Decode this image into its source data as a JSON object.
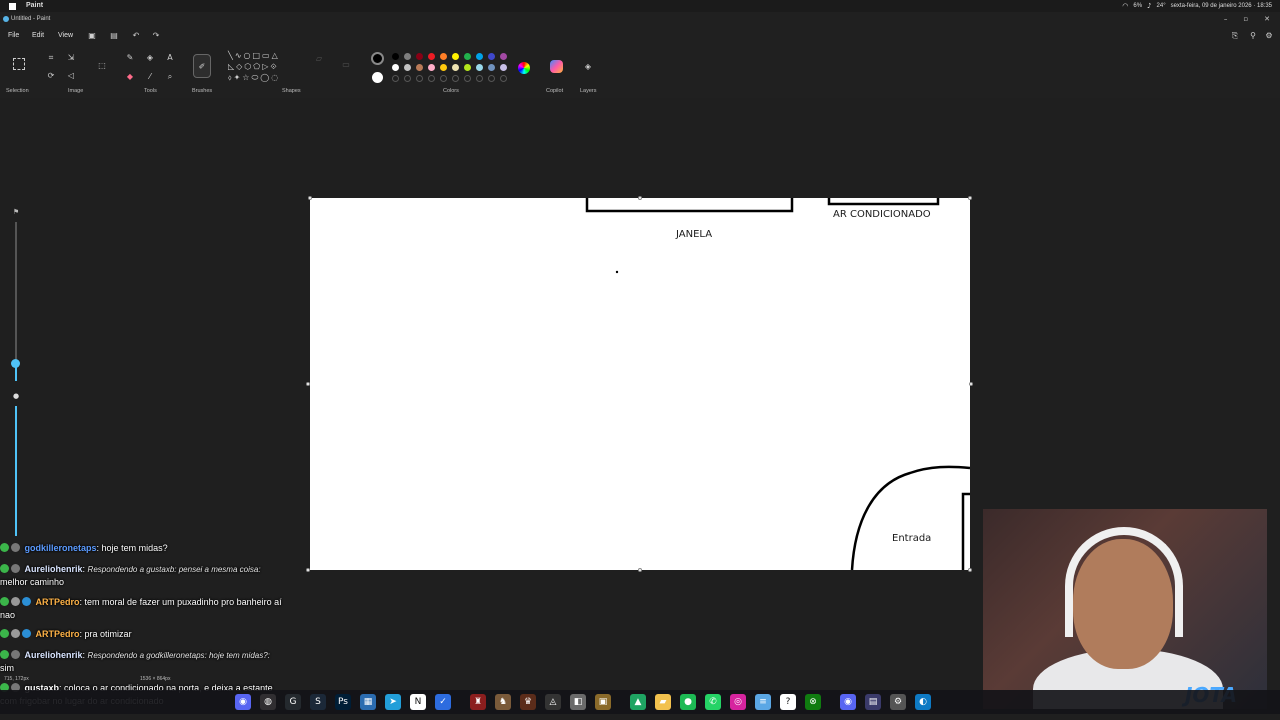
{
  "system_bar": {
    "app_name": "Paint",
    "temperature": "24°",
    "battery": "6%",
    "datetime": "sexta-feira, 09 de janeiro 2026 · 18:35"
  },
  "title_bar": {
    "document": "Untitled - Paint"
  },
  "menu": {
    "file": "File",
    "edit": "Edit",
    "view": "View"
  },
  "ribbon": {
    "groups": {
      "selection": "Selection",
      "image": "Image",
      "tools": "Tools",
      "brushes": "Brushes",
      "shapes": "Shapes",
      "colors": "Colors",
      "copilot": "Copilot",
      "layers": "Layers"
    },
    "palette_row1": [
      "#000000",
      "#7f7f7f",
      "#880015",
      "#ed1c24",
      "#ff7f27",
      "#fff200",
      "#22b14c",
      "#00a2e8",
      "#3f48cc",
      "#a349a4"
    ],
    "palette_row2": [
      "#ffffff",
      "#c3c3c3",
      "#b97a57",
      "#ffaec9",
      "#ffc90e",
      "#efe4b0",
      "#b5e61d",
      "#99d9ea",
      "#7092be",
      "#c8bfe7"
    ],
    "primary_color": "#000000",
    "secondary_color": "#ffffff"
  },
  "canvas": {
    "labels": {
      "window": "JANELA",
      "ac": "AR CONDICIONADO",
      "entrance": "Entrada"
    },
    "cursor_pos": "715, 172px",
    "canvas_size": "1536 × 864px"
  },
  "chat": [
    {
      "user": "godkilleronetaps",
      "user_color": "#5b9bff",
      "text": "hoje tem midas?",
      "reply": ""
    },
    {
      "user": "Aureliohenrik",
      "user_color": "#d8e4ff",
      "text": "melhor caminho",
      "reply": "Respondendo a gustaxb: pensei a mesma coisa:"
    },
    {
      "user": "ARTPedro",
      "user_color": "#ffb347",
      "text": "tem moral de fazer um puxadinho pro banheiro aí nao",
      "reply": ""
    },
    {
      "user": "ARTPedro",
      "user_color": "#ffb347",
      "text": "pra otimizar",
      "reply": ""
    },
    {
      "user": "Aureliohenrik",
      "user_color": "#d8e4ff",
      "text": "sim",
      "reply": "Respondendo a godkilleronetaps: hoje tem midas?:"
    },
    {
      "user": "gustaxb",
      "user_color": "#ffffff",
      "text": "coloca o ar condicionado na porta, e deixa a estante com frigobar no lugar do ar condicionado",
      "reply": ""
    }
  ],
  "taskbar_icons": [
    "discord",
    "obs",
    "github",
    "steam",
    "photoshop",
    "app",
    "telegram",
    "notion",
    "tick",
    "game1",
    "game2",
    "game3",
    "game4",
    "game5",
    "game6",
    "drive",
    "folder",
    "spotify",
    "whatsapp",
    "instagram",
    "notes",
    "help",
    "xbox",
    "discord2",
    "app2",
    "settings",
    "edge"
  ],
  "webcam": {
    "overlay_logo": "JOTA"
  }
}
